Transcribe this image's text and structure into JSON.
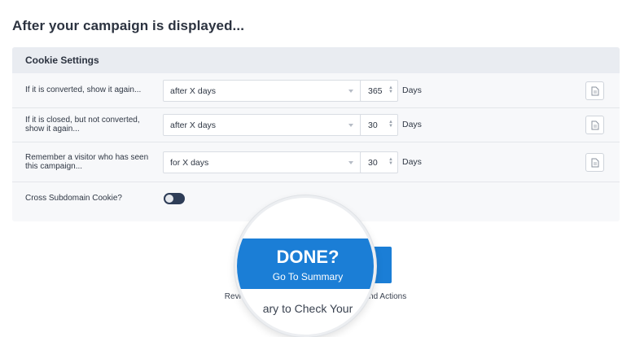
{
  "page": {
    "title": "After your campaign is displayed..."
  },
  "cookie_settings": {
    "header": "Cookie Settings",
    "rows": [
      {
        "label": "If it is converted, show it again...",
        "select_value": "after X days",
        "number": "365",
        "unit": "Days"
      },
      {
        "label": "If it is closed, but not converted, show it again...",
        "select_value": "after X days",
        "number": "30",
        "unit": "Days"
      },
      {
        "label": "Remember a visitor who has seen this campaign...",
        "select_value": "for X days",
        "number": "30",
        "unit": "Days"
      }
    ],
    "cross_subdomain": {
      "label": "Cross Subdomain Cookie?"
    }
  },
  "footer": {
    "done_label": "DONE?",
    "summary_label": "Go To Summary",
    "review_left": "Review t",
    "review_right": "es and Actions",
    "magnified_text": "ary to Check Your"
  },
  "colors": {
    "accent": "#1b7ed6",
    "toggle": "#2e3d57"
  },
  "icons": {
    "row_action": "document-icon"
  }
}
